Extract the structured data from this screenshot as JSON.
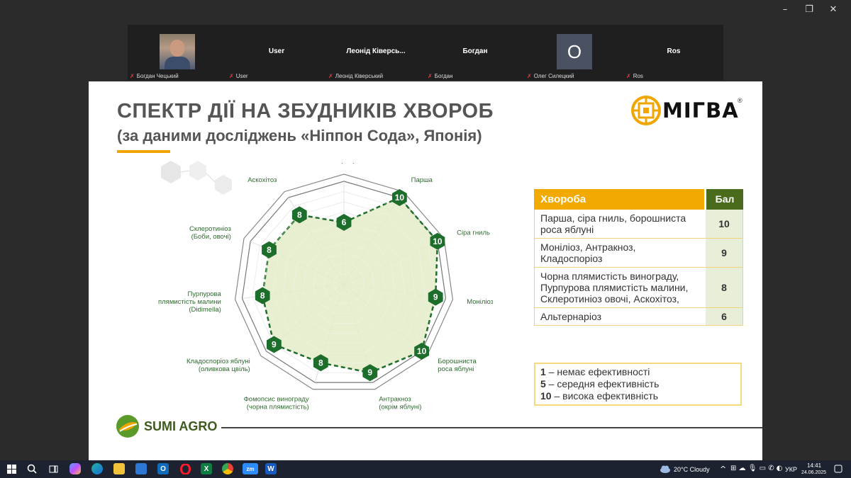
{
  "window": {
    "minimize": "–",
    "restore": "❐",
    "close": "✕"
  },
  "gallery": [
    {
      "name": "",
      "label": "Богдан Чецький",
      "type": "photo"
    },
    {
      "name": "User",
      "label": "User",
      "type": "name"
    },
    {
      "name": "Леонід Ківерсь...",
      "label": "Леонід Ківерський",
      "type": "name"
    },
    {
      "name": "Богдан",
      "label": "Богдан",
      "type": "name"
    },
    {
      "name": "",
      "label": "Олег Силецкий",
      "type": "letter",
      "letter": "О"
    },
    {
      "name": "Ros",
      "label": "Ros",
      "type": "name"
    }
  ],
  "slide": {
    "title": "СПЕКТР ДІЇ НА ЗБУДНИКІВ ХВОРОБ",
    "subtitle": "(за даними досліджень «Ніппон Сода», Японія)",
    "brand": "МІГВА",
    "brand_mark": "®",
    "footer_brand": "SUMI AGRO",
    "table": {
      "headers": [
        "Хвороба",
        "Бал"
      ],
      "rows": [
        {
          "disease": "Парша, сіра гниль, борошниста роса яблуні",
          "score": "10"
        },
        {
          "disease": "Моніліоз, Антракноз, Кладоспоріоз",
          "score": "9"
        },
        {
          "disease": "Чорна плямистість винограду, Пурпурова плямистість малини, Склеротиніоз овочі, Аскохітоз,",
          "score": "8"
        },
        {
          "disease": "Альтернаріоз",
          "score": "6"
        }
      ]
    },
    "legend": [
      {
        "num": "1",
        "text": " – немає ефективності"
      },
      {
        "num": "5",
        "text": " – середня ефективність"
      },
      {
        "num": "10",
        "text": " – висока ефективність"
      }
    ]
  },
  "chart_data": {
    "type": "radar",
    "max": 10,
    "axes": [
      {
        "label": [
          "Альтернаріоз"
        ],
        "value": 6
      },
      {
        "label": [
          "Парша"
        ],
        "value": 10
      },
      {
        "label": [
          "Сіра гниль"
        ],
        "value": 10
      },
      {
        "label": [
          "Моніліоз"
        ],
        "value": 9
      },
      {
        "label": [
          "Борошниста",
          "роса яблуні"
        ],
        "value": 10
      },
      {
        "label": [
          "Антракноз",
          "(окрім яблуні)"
        ],
        "value": 9
      },
      {
        "label": [
          "Фомопсис винограду",
          "(чорна плямистість)"
        ],
        "value": 8
      },
      {
        "label": [
          "Кладоспоріоз яблуні",
          "(оливкова цвіль)"
        ],
        "value": 9
      },
      {
        "label": [
          "Пурпурова",
          "плямистість малини",
          "(Didimella)"
        ],
        "value": 8
      },
      {
        "label": [
          "Склеротиніоз",
          "(Боби, овочі)"
        ],
        "value": 8
      },
      {
        "label": [
          "Аскохітоз"
        ],
        "value": 8
      }
    ],
    "fill_color": "#e4ebc8",
    "marker_color": "#1d6e2a",
    "line_color": "#1d6e2a"
  },
  "taskbar": {
    "weather": "20°C  Cloudy",
    "lang": "УКР",
    "time": "14:41",
    "date": "24.06.2025",
    "apps": [
      "start",
      "search",
      "task-view",
      "copilot",
      "edge",
      "explorer",
      "store",
      "outlook",
      "opera",
      "excel",
      "chrome",
      "zoom",
      "word"
    ]
  }
}
